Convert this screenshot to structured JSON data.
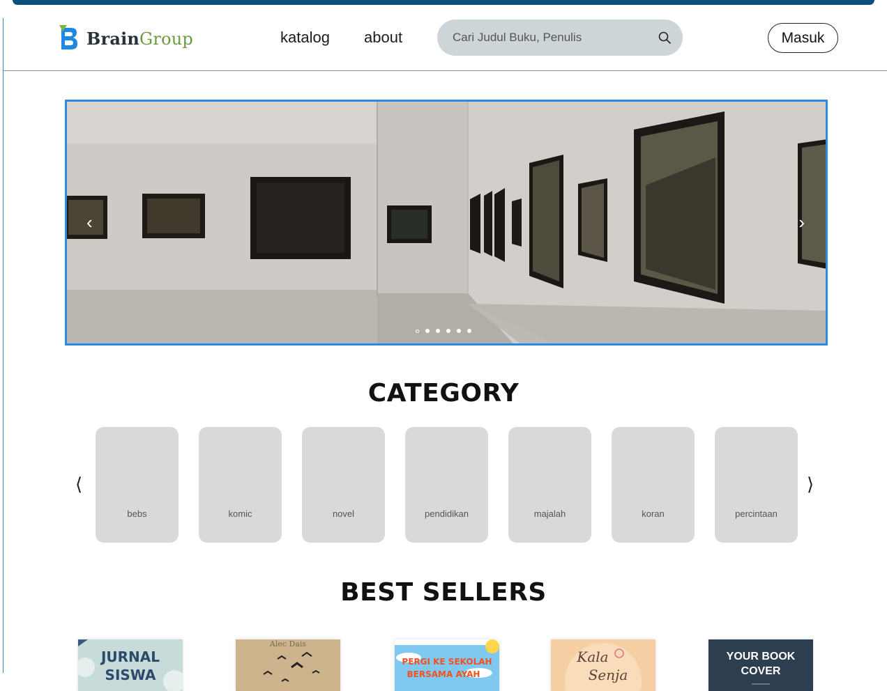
{
  "header": {
    "logo": {
      "brain": "Brain",
      "group": "Group"
    },
    "nav": {
      "katalog": "katalog",
      "about": "about"
    },
    "search": {
      "placeholder": "Cari Judul Buku, Penulis"
    },
    "login_label": "Masuk"
  },
  "carousel": {
    "prev": "‹",
    "next": "›",
    "slide_count": 6,
    "active_slide": 1
  },
  "category": {
    "title": "CATEGORY",
    "prev": "⟨",
    "next": "⟩",
    "items": [
      "bebs",
      "komic",
      "novel",
      "pendidikan",
      "majalah",
      "koran",
      "percintaan"
    ]
  },
  "best_sellers": {
    "title": "BEST SELLERS",
    "books": [
      {
        "cover_text": [
          "JURNAL",
          "SISWA"
        ]
      },
      {
        "cover_text": [
          "Alec Dais"
        ]
      },
      {
        "cover_text": [
          "PERGI KE SEKOLAH",
          "BERSAMA AYAH"
        ]
      },
      {
        "cover_text": [
          "Kala",
          "Senja"
        ]
      },
      {
        "cover_text": [
          "YOUR BOOK",
          "COVER"
        ]
      }
    ]
  },
  "colors": {
    "accent_blue": "#2a8ae0",
    "logo_green": "#6c9a3c",
    "search_bg": "#cdd5d8",
    "category_card": "#d9d9d9"
  }
}
